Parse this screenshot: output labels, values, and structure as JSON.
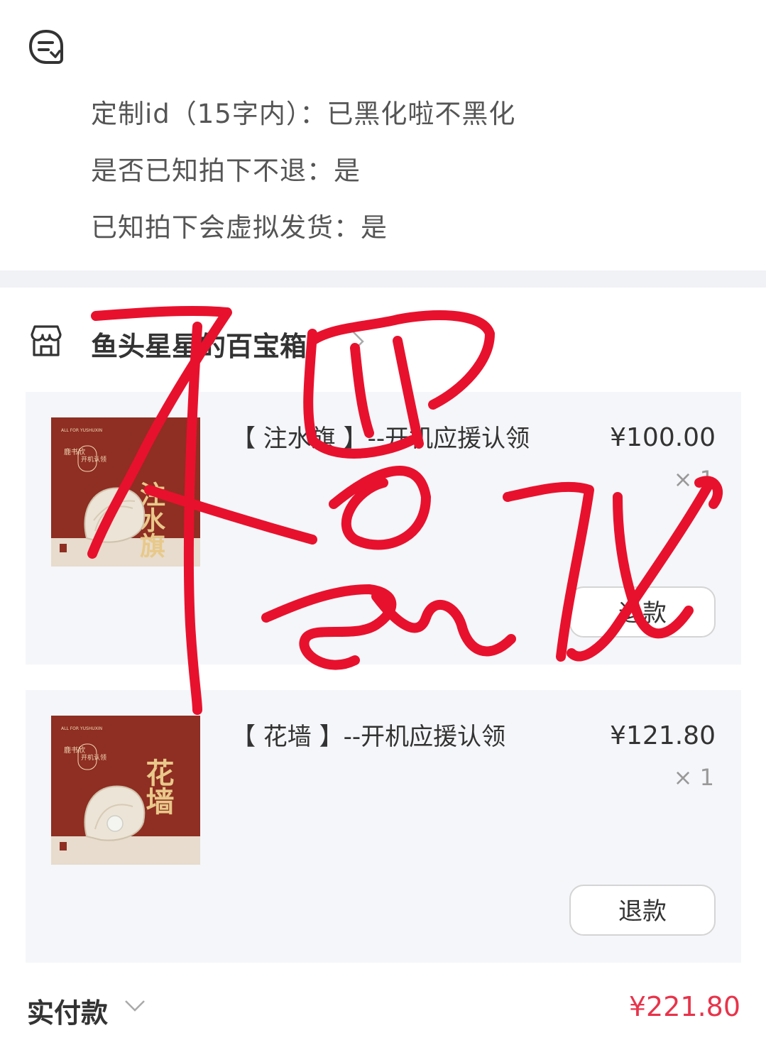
{
  "specs": [
    "定制id（15字内）：已黑化啦不黑化",
    "是否已知拍下不退：是",
    "已知拍下会虚拟发货：是"
  ],
  "shop": {
    "name": "鱼头星星的百宝箱"
  },
  "items": [
    {
      "title": "【 注水旗 】--开机应援认领",
      "price": "¥100.00",
      "qty": "× 1",
      "refund_label": "退款",
      "thumb_text": "注水旗",
      "thumb_badge": "开机认领",
      "thumb_author": "鹿书欣"
    },
    {
      "title": "【 花墙 】--开机应援认领",
      "price": "¥121.80",
      "qty": "× 1",
      "refund_label": "退款",
      "thumb_text": "花墙",
      "thumb_badge": "开机认领",
      "thumb_author": "鹿书欣"
    }
  ],
  "total": {
    "label": "实付款",
    "value": "¥221.80"
  },
  "handwriting": "不黑化",
  "colors": {
    "accent": "#e8334a",
    "scribble": "#e8112d",
    "thumb_bg": "#8f2e22"
  }
}
